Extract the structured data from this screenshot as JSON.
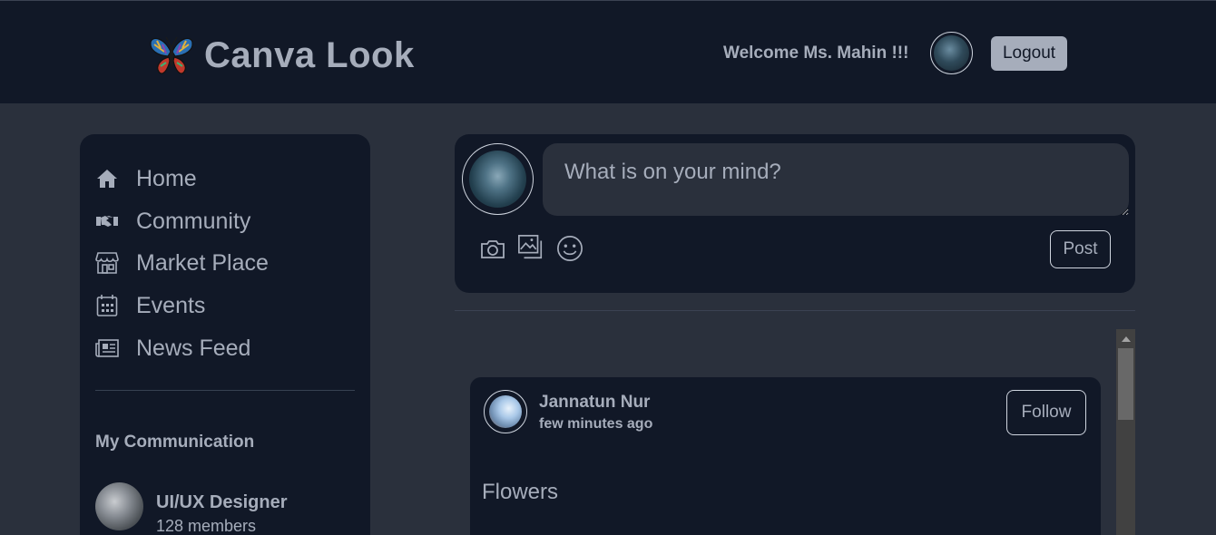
{
  "header": {
    "brand_title": "Canva Look",
    "welcome_text": "Welcome Ms. Mahin !!!",
    "logout_label": "Logout"
  },
  "sidebar": {
    "nav": [
      {
        "label": "Home",
        "icon": "home-icon"
      },
      {
        "label": "Community",
        "icon": "handshake-icon"
      },
      {
        "label": "Market Place",
        "icon": "store-icon"
      },
      {
        "label": "Events",
        "icon": "calendar-icon"
      },
      {
        "label": "News Feed",
        "icon": "newspaper-icon"
      }
    ],
    "section_title": "My Communication",
    "groups": [
      {
        "name": "UI/UX Designer",
        "members": "128 members"
      }
    ]
  },
  "composer": {
    "placeholder": "What is on your mind?",
    "post_label": "Post",
    "icons": [
      "camera-icon",
      "gallery-icon",
      "emoji-icon"
    ]
  },
  "feed": {
    "posts": [
      {
        "author": "Jannatun Nur",
        "time": "few minutes ago",
        "follow_label": "Follow",
        "title": "Flowers"
      }
    ]
  },
  "colors": {
    "header_bg": "#111827",
    "page_bg": "#2a303c",
    "text": "#a6adbb",
    "logout_bg": "#a6adbb"
  }
}
